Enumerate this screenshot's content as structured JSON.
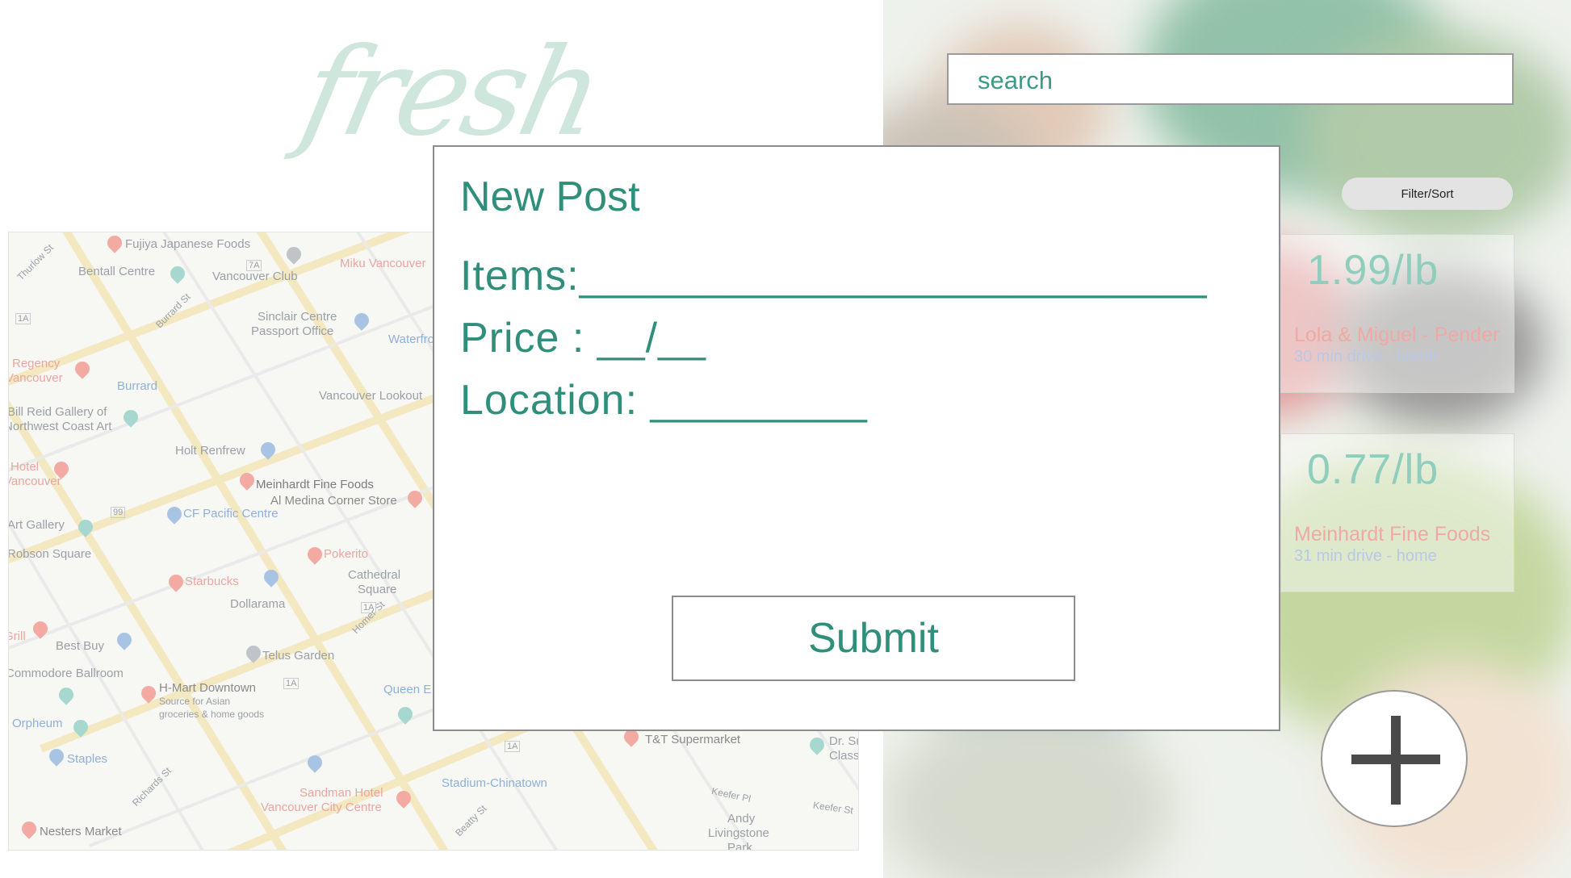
{
  "app": {
    "logo": "fresh"
  },
  "search": {
    "placeholder": "search"
  },
  "filter": {
    "label": "Filter/Sort"
  },
  "listings": [
    {
      "price": "1.99/lb",
      "store": "Lola & Miguel - Pender",
      "meta": "30 min drive - home"
    },
    {
      "price": "0.77/lb",
      "store": "Meinhardt Fine Foods",
      "meta": "31 min drive - home"
    }
  ],
  "modal": {
    "title": "New Post",
    "items": "Items:__________________________",
    "price": "Price : __/__",
    "location": "Location: _________",
    "submit": "Submit"
  },
  "map": {
    "labels": [
      "Fujiya Japanese Foods",
      "Bentall Centre",
      "Vancouver Club",
      "Miku Vancouver",
      "Sinclair Centre",
      "Passport Office",
      "Waterfront",
      "Regency",
      "Vancouver",
      "Burrard",
      "Bill Reid Gallery of",
      "Northwest Coast Art",
      "Vancouver Lookout",
      "Holt Renfrew",
      "Hotel",
      "Vancouver",
      "Meinhardt Fine Foods",
      "Al Medina Corner Store",
      "CF Pacific Centre",
      "Art Gallery",
      "Robson Square",
      "Pokerito",
      "Starbucks",
      "Cathedral",
      "Square",
      "Dollarama",
      "Grill",
      "Best Buy",
      "Telus Garden",
      "Commodore Ballroom",
      "H-Mart Downtown",
      "Source for Asian",
      "groceries & home goods",
      "Queen E",
      "Orpheum",
      "Staples",
      "T&T Supermarket",
      "Dr. Sun",
      "Classical",
      "Stadium-Chinatown",
      "Sandman Hotel",
      "Vancouver City Centre",
      "Nesters Market",
      "Andy",
      "Livingstone",
      "Park",
      "Thurlow St",
      "Burrard St",
      "Homer St",
      "Richards St",
      "Beatty St",
      "Keefer Pl",
      "Keefer St",
      "7A",
      "1A",
      "99",
      "1A",
      "1A",
      "1A"
    ]
  },
  "colors": {
    "accent": "#2f8f7a",
    "logo": "#cfe6dc",
    "price": "#8fcdbd",
    "store": "#f0a9a2",
    "meta": "#b8c8e6"
  },
  "icons": {
    "add": "plus-icon"
  }
}
